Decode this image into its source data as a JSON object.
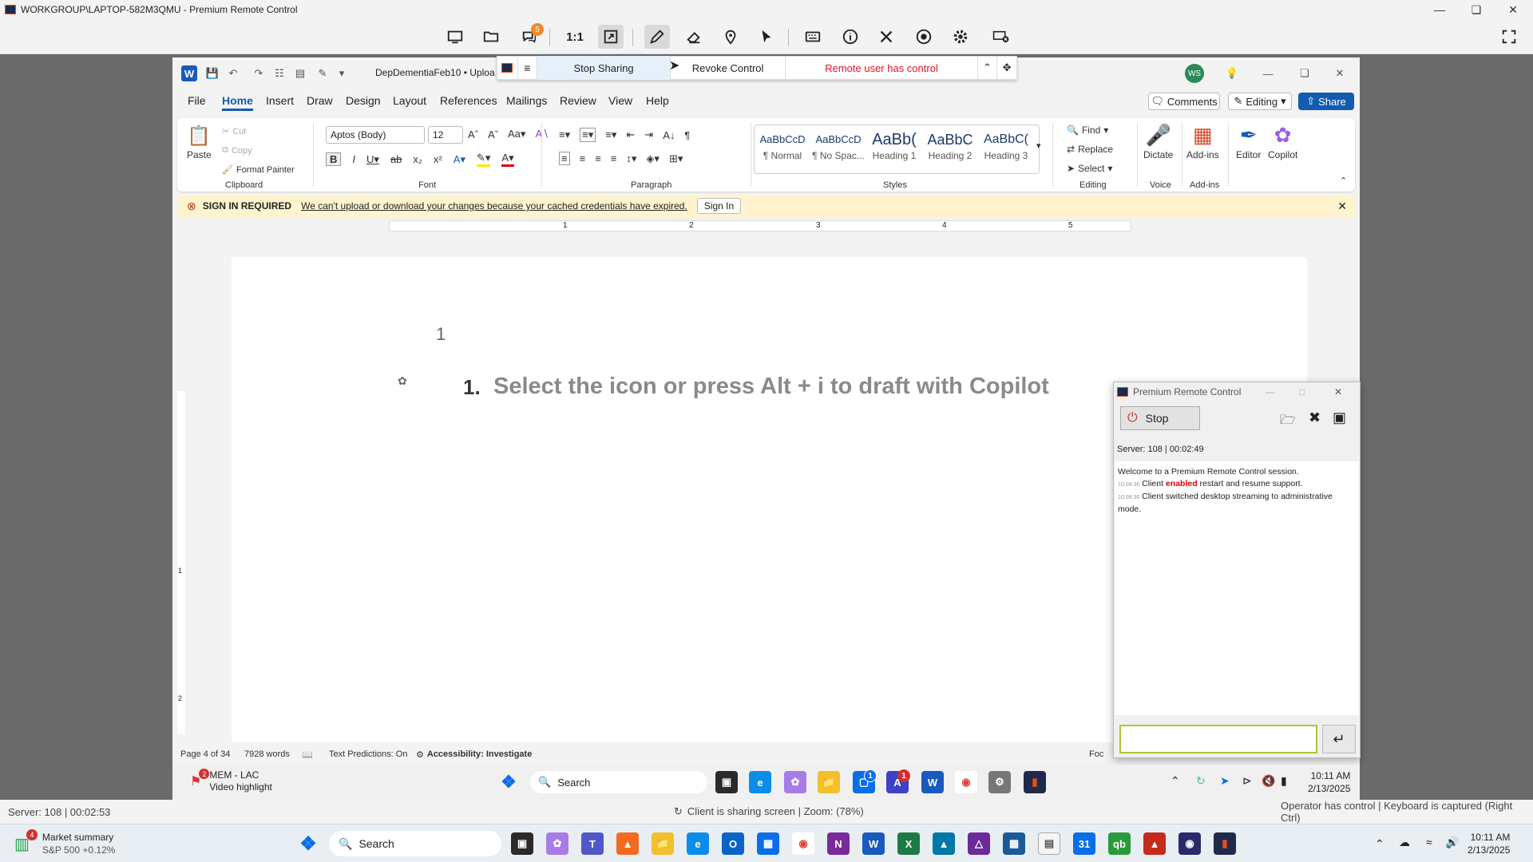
{
  "window": {
    "title": "WORKGROUP\\LAPTOP-582M3QMU - Premium Remote Control"
  },
  "toolbar": {
    "chat_badge": "5",
    "scale_label": "1:1"
  },
  "share_bar": {
    "stop_sharing": "Stop Sharing",
    "revoke_control": "Revoke Control",
    "remote_status": "Remote user has control",
    "status_color": "#e81123"
  },
  "word": {
    "doc_name": "DepDementiaFeb10 • Uploa",
    "avatar": "WS",
    "menu": [
      "File",
      "Home",
      "Insert",
      "Draw",
      "Design",
      "Layout",
      "References",
      "Mailings",
      "Review",
      "View",
      "Help"
    ],
    "comments_label": "Comments",
    "editing_label": "Editing",
    "share_label": "Share",
    "clipboard": {
      "paste": "Paste",
      "cut": "Cut",
      "copy": "Copy",
      "format_painter": "Format Painter",
      "group": "Clipboard"
    },
    "font": {
      "name": "Aptos (Body)",
      "size": "12",
      "group": "Font"
    },
    "paragraph_group": "Paragraph",
    "styles": [
      {
        "preview": "AaBbCcD",
        "name": "¶ Normal"
      },
      {
        "preview": "AaBbCcD",
        "name": "¶ No Spac..."
      },
      {
        "preview": "AaBb(",
        "name": "Heading 1"
      },
      {
        "preview": "AaBbC",
        "name": "Heading 2"
      },
      {
        "preview": "AaBbC(",
        "name": "Heading 3"
      }
    ],
    "styles_group": "Styles",
    "editing": {
      "find": "Find",
      "replace": "Replace",
      "select": "Select",
      "group": "Editing"
    },
    "voice": {
      "dictate": "Dictate",
      "group": "Voice"
    },
    "addins": {
      "label": "Add-ins",
      "group": "Add-ins"
    },
    "editor": "Editor",
    "copilot": "Copilot",
    "signin_bar": {
      "title": "SIGN IN REQUIRED",
      "message": "We can't upload or download your changes because your cached credentials have expired.",
      "button": "Sign In"
    },
    "ruler_nums": [
      "1",
      "2",
      "3",
      "4",
      "5"
    ],
    "vruler_nums": [
      "1",
      "2"
    ],
    "page": {
      "page_number": "1",
      "list_number": "1.",
      "placeholder": "Select the icon or press Alt + i to draft with Copilot"
    },
    "status": {
      "page": "Page 4 of 34",
      "words": "7928 words",
      "predictions": "Text Predictions: On",
      "accessibility": "Accessibility: Investigate",
      "focus": "Foc"
    }
  },
  "prc_panel": {
    "title": "Premium Remote Control",
    "stop": "Stop",
    "server": "Server: 108 | 00:02:49",
    "log": [
      {
        "time": "",
        "pre": "Welcome to a Premium Remote Control session.",
        "em": "",
        "post": ""
      },
      {
        "time": "10:08:36",
        "pre": "Client ",
        "em": "enabled",
        "post": " restart and resume support."
      },
      {
        "time": "10:08:36",
        "pre": "Client switched desktop streaming to administrative mode.",
        "em": "",
        "post": ""
      }
    ]
  },
  "inner_taskbar": {
    "news_badge": "2",
    "news_title": "MEM - LAC",
    "news_sub": "Video highlight",
    "search": "Search",
    "time": "10:11 AM",
    "date": "2/13/2025",
    "teams_badge": "1",
    "mail_badge": "1"
  },
  "outer_status": {
    "server": "Server: 108 | 00:02:53",
    "center": "Client is sharing screen | Zoom: (78%)",
    "right": "Operator has control | Keyboard is captured (Right Ctrl)"
  },
  "outer_taskbar": {
    "widget_badge": "4",
    "widget_title": "Market summary",
    "widget_sub": "S&P 500 +0.12%",
    "search": "Search",
    "time": "10:11 AM",
    "date": "2/13/2025"
  }
}
